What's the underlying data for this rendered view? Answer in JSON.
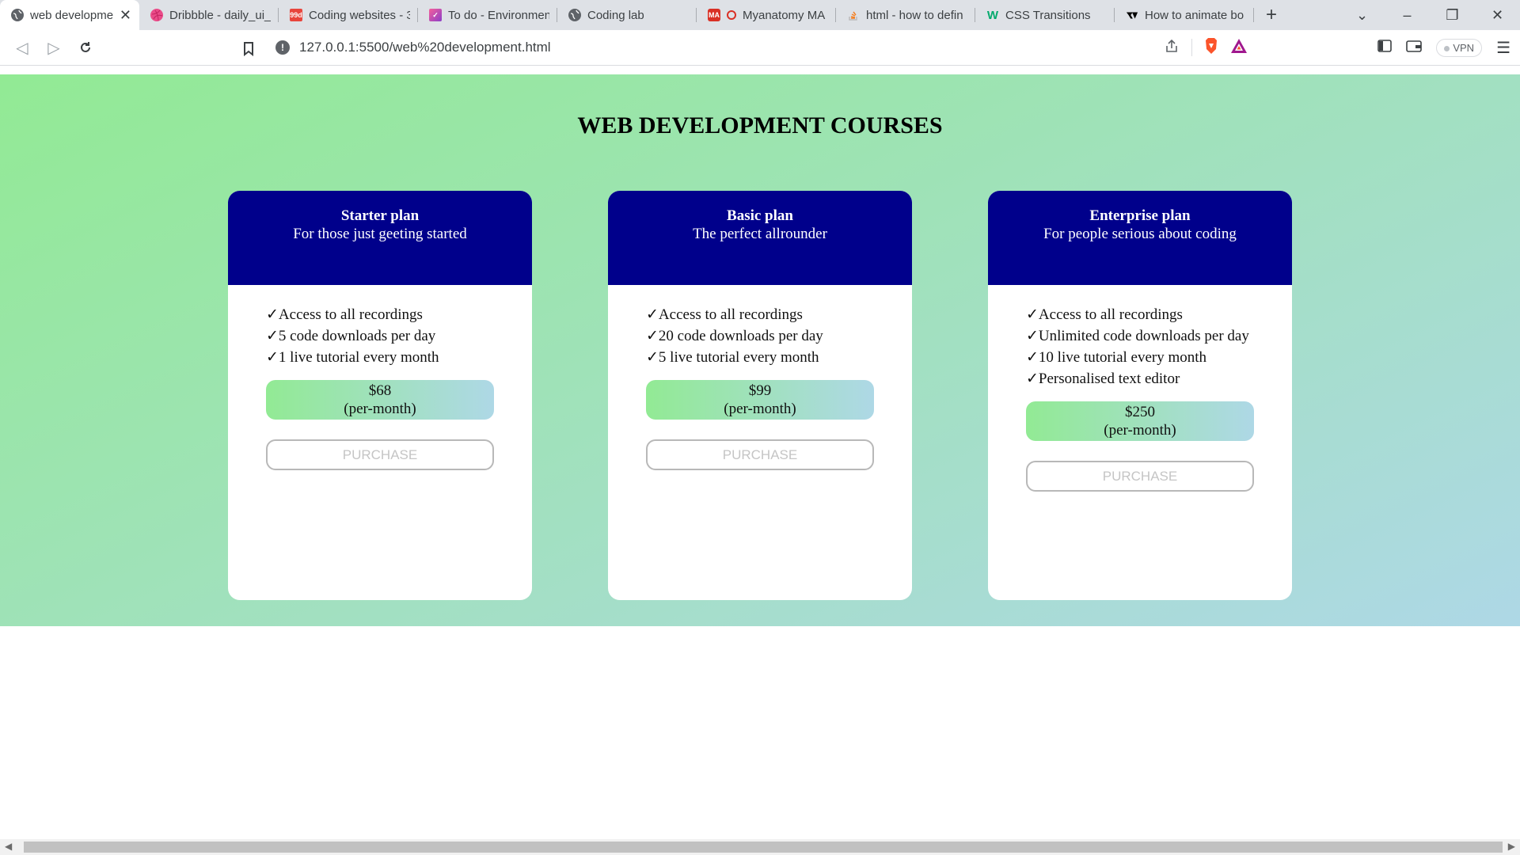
{
  "browser": {
    "tabs": [
      {
        "title": "web development",
        "favicon": "globe-icon",
        "color": "#5f6368",
        "active": true
      },
      {
        "title": "Dribbble - daily_ui_",
        "favicon": "dribbble-icon",
        "color": "#ea4c89"
      },
      {
        "title": "Coding websites - 3",
        "favicon": "99d-icon",
        "color": "#e8453c",
        "badge": "99d"
      },
      {
        "title": "To do - Environmen",
        "favicon": "todo-icon",
        "color": "#c13ab8"
      },
      {
        "title": "Coding lab",
        "favicon": "globe-icon",
        "color": "#5f6368"
      },
      {
        "title": "Myanatomy MA",
        "favicon": "myanatomy-icon",
        "color": "#d93025",
        "badge": "MA"
      },
      {
        "title": "html - how to defin",
        "favicon": "stackoverflow-icon",
        "color": "#f48024"
      },
      {
        "title": "CSS Transitions",
        "favicon": "w3schools-icon",
        "color": "#04aa6d",
        "badge": "W"
      },
      {
        "title": "How to animate bo",
        "favicon": "site-icon",
        "color": "#000000"
      }
    ],
    "url": "127.0.0.1:5500/web%20development.html",
    "vpn_label": "VPN"
  },
  "page": {
    "heading": "WEB DEVELOPMENT COURSES",
    "plans": [
      {
        "name": "Starter plan",
        "subtitle": "For those just geeting started",
        "features": [
          "Access to all recordings",
          "5 code downloads per day",
          "1 live tutorial every month"
        ],
        "price": "$68",
        "period": "(per-month)",
        "button": "Purchase"
      },
      {
        "name": "Basic plan",
        "subtitle": "The perfect allrounder",
        "features": [
          "Access to all recordings",
          "20 code downloads per day",
          "5 live tutorial every month"
        ],
        "price": "$99",
        "period": "(per-month)",
        "button": "Purchase"
      },
      {
        "name": "Enterprise plan",
        "subtitle": "For people serious about coding",
        "features": [
          "Access to all recordings",
          "Unlimited code downloads per day",
          "10 live tutorial every month",
          "Personalised text editor"
        ],
        "price": "$250",
        "period": "(per-month)",
        "button": "Purchase"
      }
    ]
  },
  "colors": {
    "card_header": "#00008b",
    "gradient_start": "#92ea94",
    "gradient_end": "#aed8e6"
  }
}
